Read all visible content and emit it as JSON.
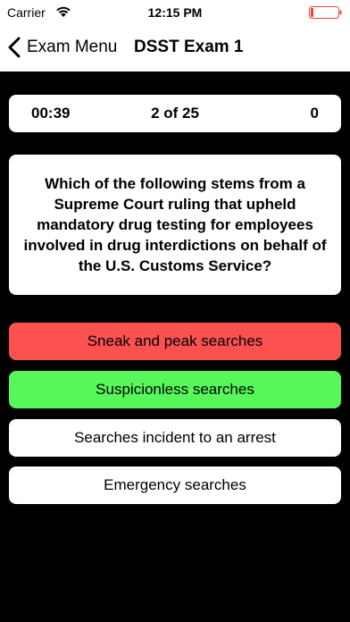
{
  "status_bar": {
    "carrier": "Carrier",
    "time": "12:15 PM",
    "wifi_icon": "wifi-icon",
    "battery_icon": "battery-icon",
    "battery_level": 0.1,
    "battery_color": "#ff3b30"
  },
  "nav": {
    "back_label": "Exam Menu",
    "back_icon": "chevron-left-icon",
    "title": "DSST Exam 1"
  },
  "quiz_info": {
    "timer": "00:39",
    "progress": "2 of 25",
    "score": "0"
  },
  "question": {
    "text": "Which of the following stems from a Supreme Court ruling that upheld mandatory drug testing for employees involved in drug interdictions on behalf of the U.S. Customs Service?"
  },
  "answers": [
    {
      "label": "Sneak and peak searches",
      "state": "incorrect",
      "color": "#fb5151"
    },
    {
      "label": "Suspicionless searches",
      "state": "correct",
      "color": "#57f65a"
    },
    {
      "label": "Searches incident to an arrest",
      "state": "default",
      "color": "#ffffff"
    },
    {
      "label": "Emergency searches",
      "state": "default",
      "color": "#ffffff"
    }
  ]
}
